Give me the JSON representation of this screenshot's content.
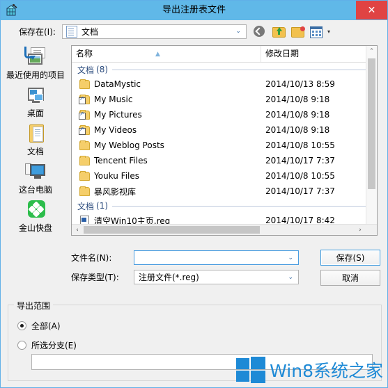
{
  "window": {
    "title": "导出注册表文件",
    "title_icon": "registry-editor-icon",
    "close_label": "✕",
    "accent_color": "#60b8e8",
    "close_color": "#e04343"
  },
  "toolbar": {
    "lookin_label": "保存在(I):",
    "lookin_value": "文档",
    "lookin_icon": "document-folder-icon",
    "dropdown_caret": "⌄",
    "icons": [
      {
        "name": "back-icon",
        "title": ""
      },
      {
        "name": "up-folder-icon",
        "title": ""
      },
      {
        "name": "new-folder-icon",
        "title": ""
      },
      {
        "name": "views-icon",
        "title": ""
      }
    ],
    "views_caret": "▾"
  },
  "places": [
    {
      "label": "最近使用的项目",
      "icon": "recent-items-icon"
    },
    {
      "label": "桌面",
      "icon": "desktop-icon"
    },
    {
      "label": "文档",
      "icon": "documents-icon"
    },
    {
      "label": "这台电脑",
      "icon": "this-pc-icon"
    },
    {
      "label": "金山快盘",
      "icon": "kingsoft-kuaipan-icon"
    }
  ],
  "filelist": {
    "columns": {
      "name": "名称",
      "date": "修改日期"
    },
    "sort_caret": "▲",
    "groups": [
      {
        "label": "文档",
        "count": "(8)",
        "rows": [
          {
            "name": "DataMystic",
            "date": "2014/10/13 8:59",
            "icon": "folder-icon"
          },
          {
            "name": "My Music",
            "date": "2014/10/8 9:18",
            "icon": "shortcut-folder-icon"
          },
          {
            "name": "My Pictures",
            "date": "2014/10/8 9:18",
            "icon": "shortcut-folder-icon"
          },
          {
            "name": "My Videos",
            "date": "2014/10/8 9:18",
            "icon": "shortcut-folder-icon"
          },
          {
            "name": "My Weblog Posts",
            "date": "2014/10/8 10:55",
            "icon": "folder-icon"
          },
          {
            "name": "Tencent Files",
            "date": "2014/10/17 7:37",
            "icon": "folder-icon"
          },
          {
            "name": "Youku Files",
            "date": "2014/10/8 10:55",
            "icon": "folder-icon"
          },
          {
            "name": "暴风影视库",
            "date": "2014/10/17 7:37",
            "icon": "folder-icon"
          }
        ]
      },
      {
        "label": "文档",
        "count": "(1)",
        "rows": [
          {
            "name": "清空Win10主页.reg",
            "date": "2014/10/17 8:42",
            "icon": "reg-file-icon"
          }
        ]
      }
    ],
    "scroll": {
      "up_arrow": "⌃",
      "down_arrow": "⌄",
      "left_arrow": "‹",
      "right_arrow": "›"
    }
  },
  "form": {
    "filename_label": "文件名(N):",
    "filename_value": "",
    "filename_placeholder": "",
    "filetype_label": "保存类型(T):",
    "filetype_value": "注册文件(*.reg)",
    "dropdown_caret": "⌄",
    "save_label": "保存(S)",
    "cancel_label": "取消"
  },
  "export_range": {
    "title": "导出范围",
    "options": [
      {
        "label": "全部(A)",
        "selected": true
      },
      {
        "label": "所选分支(E)",
        "selected": false
      }
    ],
    "branch_value": ""
  },
  "watermark": {
    "text": "Win8系统之家",
    "logo": "windows-logo-icon",
    "color": "#1e8ad6"
  }
}
